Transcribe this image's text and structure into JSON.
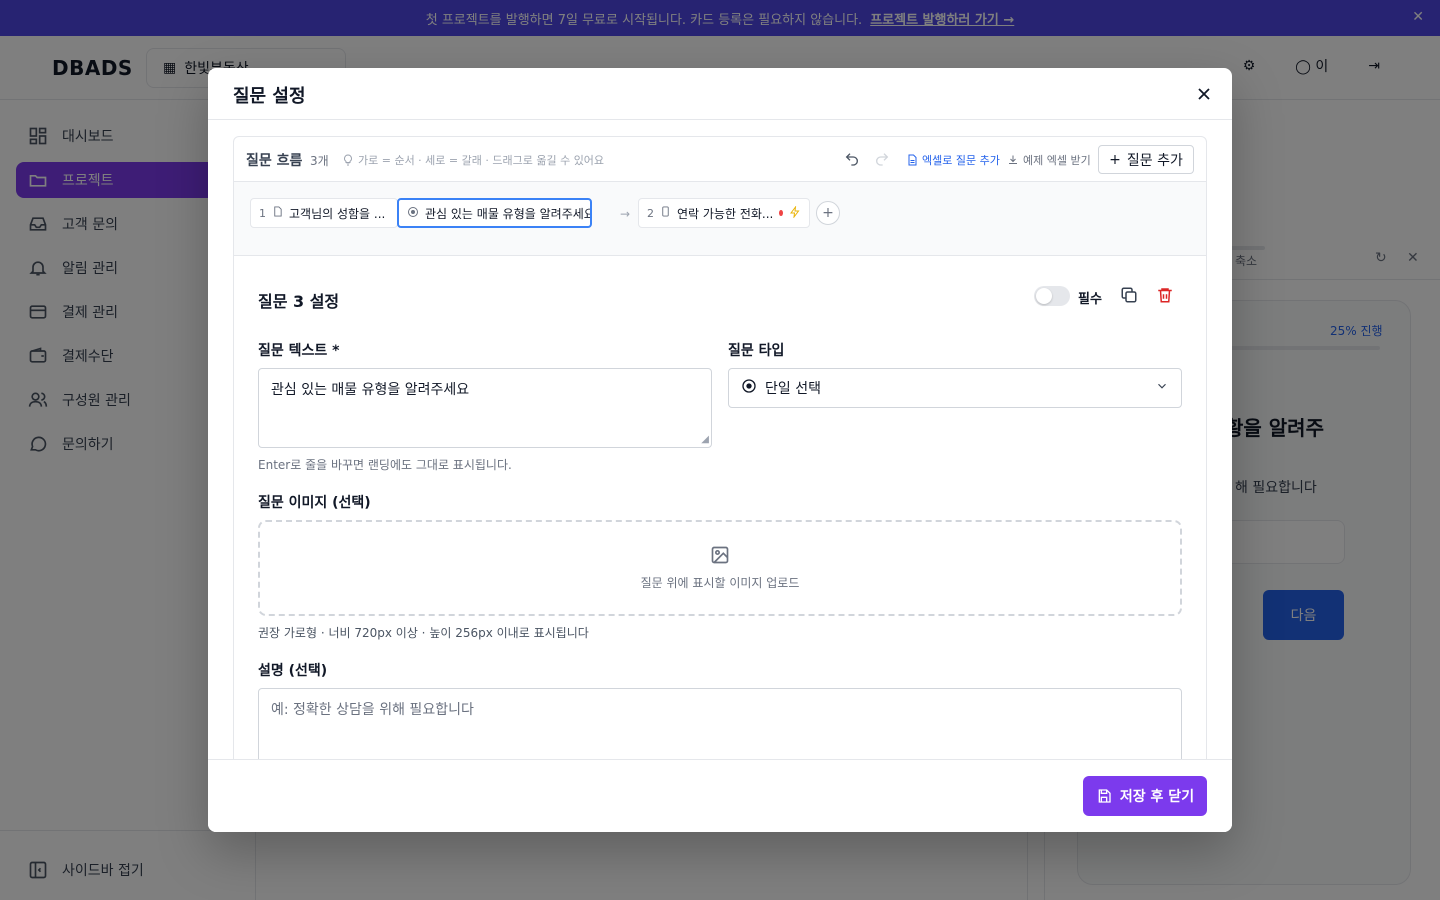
{
  "banner": {
    "text": "첫 프로젝트를 발행하면 7일 무료로 시작됩니다. 카드 등록은 필요하지 않습니다.",
    "link": "프로젝트 발행하러 가기 →"
  },
  "app": {
    "logo": "DBADS",
    "workspace": "한빛부동산",
    "user_initial": "이"
  },
  "sidebar": {
    "items": [
      {
        "label": "대시보드",
        "icon": "dashboard-icon"
      },
      {
        "label": "프로젝트",
        "icon": "folder-icon",
        "active": true
      },
      {
        "label": "고객 문의",
        "icon": "inbox-icon"
      },
      {
        "label": "알림 관리",
        "icon": "bell-icon"
      },
      {
        "label": "결제 관리",
        "icon": "card-icon"
      },
      {
        "label": "결제수단",
        "icon": "wallet-icon"
      },
      {
        "label": "구성원 관리",
        "icon": "users-icon"
      },
      {
        "label": "문의하기",
        "icon": "chat-icon"
      }
    ],
    "collapse_label": "사이드바 접기"
  },
  "preview": {
    "shrink_label": "축소",
    "progress_label": "25% 진행",
    "progress_value": 0.25,
    "question_fragment": "황을 알려주",
    "help_fragment": "해 필요합니다",
    "next_label": "다음"
  },
  "modal": {
    "title": "질문 설정",
    "flow": {
      "title": "질문 흐름",
      "count": "3개",
      "hint": "가로 = 순서 · 세로 = 갈래 · 드래그로 옮길 수 있어요",
      "excel_add": "엑셀로 질문 추가",
      "sample_download": "예제 엑셀 받기",
      "add_question": "질문 추가",
      "chips": [
        {
          "num": "1",
          "label": "고객님의 성함을 ...",
          "icon": "document-icon",
          "dot": true
        },
        {
          "num": "",
          "label": "관심 있는 매물 유형을 알려주세요",
          "icon": "radio-icon",
          "active": true
        },
        {
          "num": "2",
          "label": "연락 가능한 전화...",
          "icon": "phone-icon",
          "dot": true,
          "bolt": true
        }
      ]
    },
    "settings": {
      "title": "질문 3 설정",
      "required_label": "필수",
      "required": false,
      "question_text_label": "질문 텍스트 *",
      "question_text_value": "관심 있는 매물 유형을 알려주세요",
      "question_text_hint": "Enter로 줄을 바꾸면 랜딩에도 그대로 표시됩니다.",
      "question_type_label": "질문 타입",
      "question_type_value": "단일 선택",
      "image_label": "질문 이미지 (선택)",
      "image_upload_text": "질문 위에 표시할 이미지 업로드",
      "image_hint": "권장 가로형 · 너비 720px 이상 · 높이 256px 이내로 표시됩니다",
      "description_label": "설명 (선택)",
      "description_placeholder": "예: 정확한 상담을 위해 필요합니다"
    },
    "save_label": "저장 후 닫기"
  },
  "colors": {
    "brand": "#7c3aed",
    "banner": "#4f46e5",
    "link": "#2563eb",
    "danger": "#dc2626"
  }
}
